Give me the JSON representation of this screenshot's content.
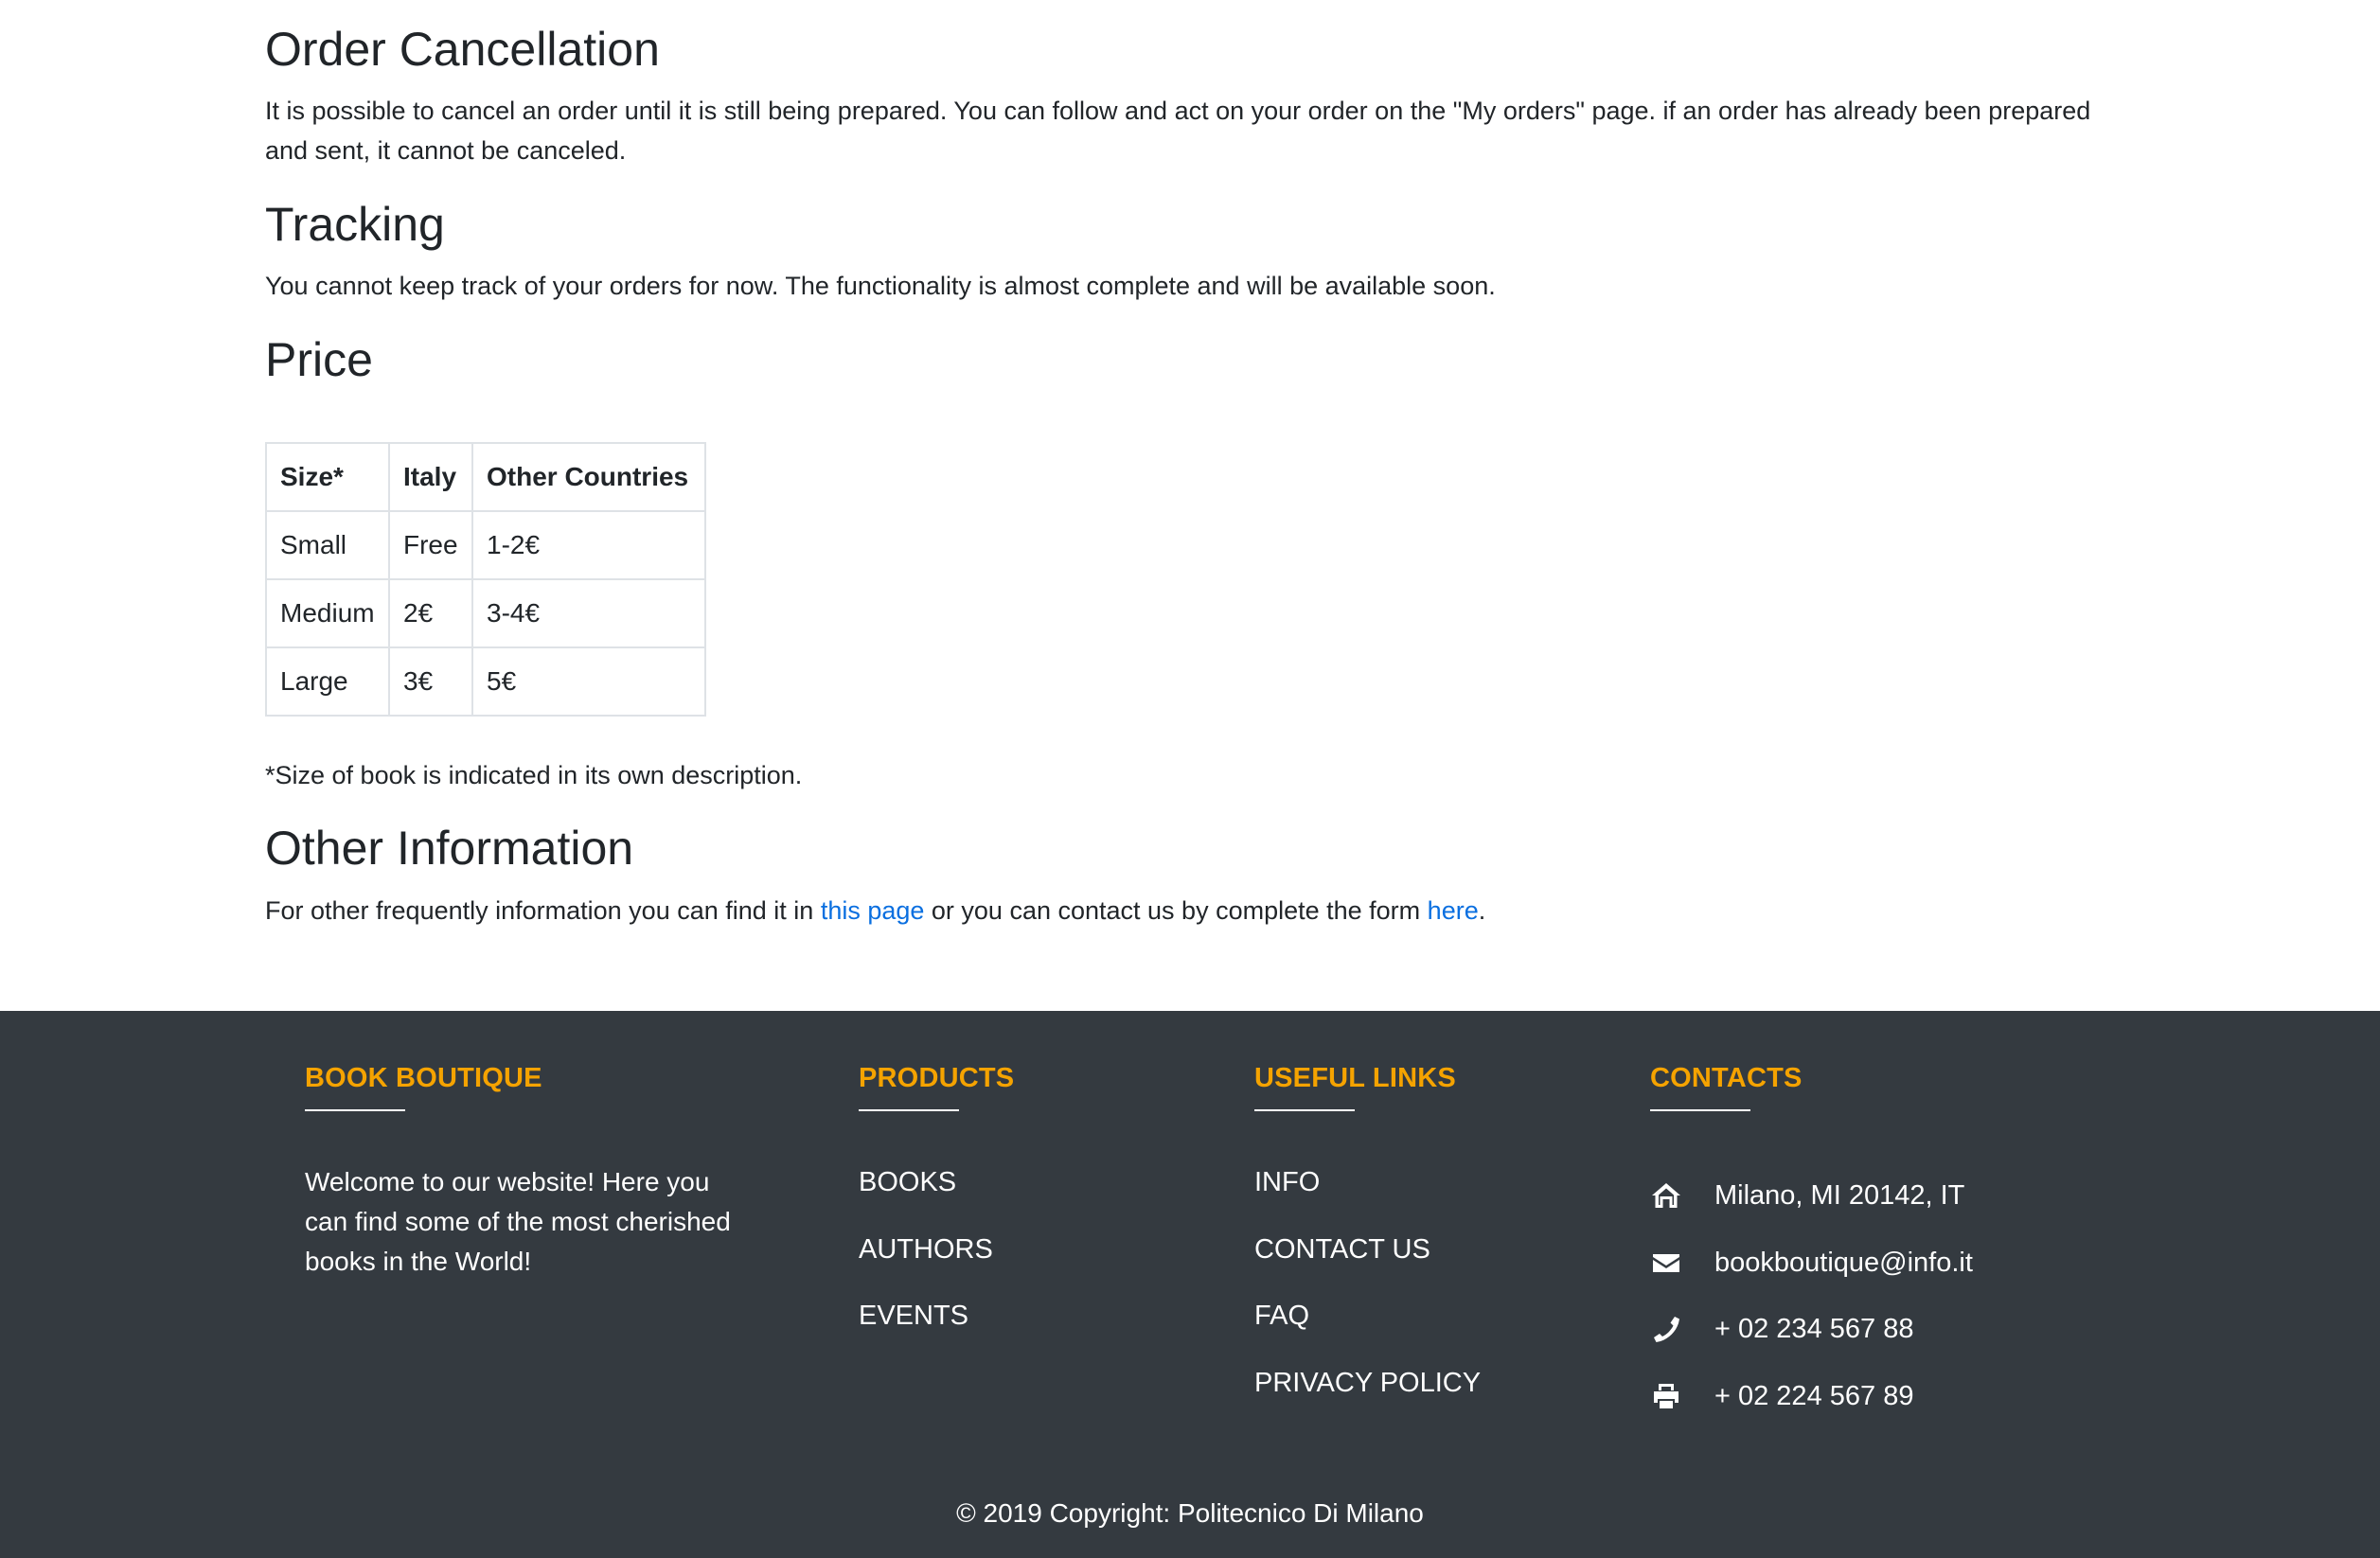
{
  "sections": {
    "cancellation": {
      "title": "Order Cancellation",
      "text": "It is possible to cancel an order until it is still being prepared. You can follow and act on your order on the \"My orders\" page. if an order has already been prepared and sent, it cannot be canceled."
    },
    "tracking": {
      "title": "Tracking",
      "text": "You cannot keep track of your orders for now. The functionality is almost complete and will be available soon."
    },
    "price": {
      "title": "Price",
      "table": {
        "headers": [
          "Size*",
          "Italy",
          "Other Countries"
        ],
        "rows": [
          [
            "Small",
            "Free",
            "1-2€"
          ],
          [
            "Medium",
            "2€",
            "3-4€"
          ],
          [
            "Large",
            "3€",
            "5€"
          ]
        ]
      },
      "note": "*Size of book is indicated in its own description."
    },
    "other": {
      "title": "Other Information",
      "text_before": "For other frequently information you can find it in ",
      "link1": "this page",
      "text_middle": " or you can contact us by complete the form ",
      "link2": "here",
      "text_after": "."
    }
  },
  "footer": {
    "accent_color": "#f5a300",
    "background_color": "#343a40",
    "book_boutique": {
      "title": "BOOK BOUTIQUE",
      "text": "Welcome to our website! Here you can find some of the most cherished books in the World!"
    },
    "products": {
      "title": "PRODUCTS",
      "items": [
        "BOOKS",
        "AUTHORS",
        "EVENTS"
      ]
    },
    "useful_links": {
      "title": "USEFUL LINKS",
      "items": [
        "INFO",
        "CONTACT US",
        "FAQ",
        "PRIVACY POLICY"
      ]
    },
    "contacts": {
      "title": "CONTACTS",
      "items": [
        {
          "icon": "home-icon",
          "text": "Milano, MI 20142, IT"
        },
        {
          "icon": "envelope-icon",
          "text": "bookboutique@info.it"
        },
        {
          "icon": "phone-icon",
          "text": "+ 02 234 567 88"
        },
        {
          "icon": "print-icon",
          "text": "+ 02 224 567 89"
        }
      ]
    },
    "copyright": "© 2019 Copyright: Politecnico Di Milano"
  }
}
